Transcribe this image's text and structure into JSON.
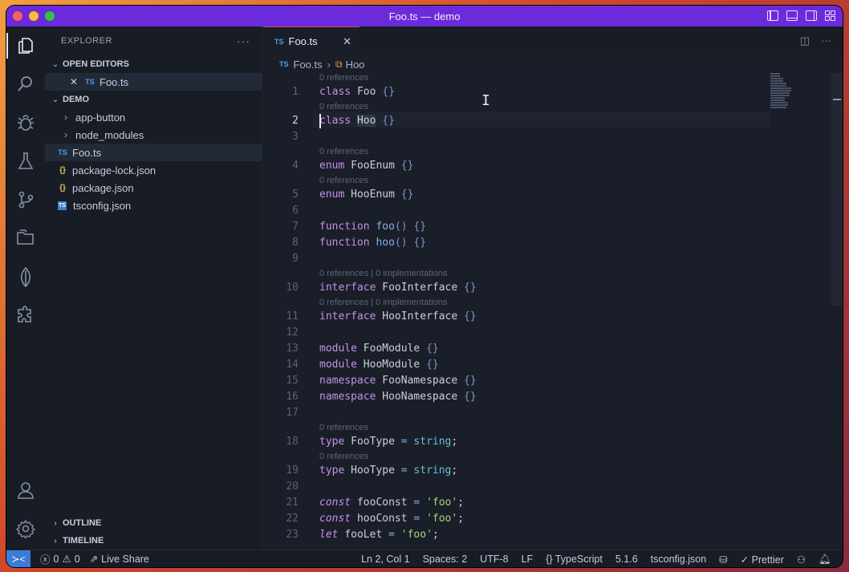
{
  "window": {
    "title": "Foo.ts — demo"
  },
  "sidebar": {
    "header": "EXPLORER",
    "more": "···",
    "open_editors": {
      "label": "OPEN EDITORS",
      "items": [
        {
          "icon": "TS",
          "label": "Foo.ts"
        }
      ]
    },
    "workspace": {
      "label": "DEMO",
      "items": [
        {
          "type": "folder",
          "label": "app-button"
        },
        {
          "type": "folder",
          "label": "node_modules"
        },
        {
          "type": "ts",
          "icon": "TS",
          "label": "Foo.ts"
        },
        {
          "type": "json",
          "icon": "{}",
          "label": "package-lock.json"
        },
        {
          "type": "json",
          "icon": "{}",
          "label": "package.json"
        },
        {
          "type": "tsconfig",
          "icon": "TS",
          "label": "tsconfig.json"
        }
      ]
    },
    "outline_label": "OUTLINE",
    "timeline_label": "TIMELINE"
  },
  "editor": {
    "tab": {
      "icon": "TS",
      "label": "Foo.ts"
    },
    "breadcrumb": {
      "file": "Foo.ts",
      "symbol": "Hoo"
    },
    "lens": {
      "ref": "0 references",
      "ref_impl": "0 references | 0 implementations"
    },
    "lines": {
      "1": "class Foo {}",
      "2": "class Hoo {}",
      "4": "enum FooEnum {}",
      "5": "enum HooEnum {}",
      "7": "function foo() {}",
      "8": "function hoo() {}",
      "10": "interface FooInterface {}",
      "11": "interface HooInterface {}",
      "13": "module FooModule {}",
      "14": "module HooModule {}",
      "15": "namespace FooNamespace {}",
      "16": "namespace HooNamespace {}",
      "18": "type FooType = string;",
      "19": "type HooType = string;",
      "21": "const fooConst = 'foo';",
      "22": "const hooConst = 'foo';",
      "23": "let fooLet = 'foo';"
    },
    "line_numbers": [
      "1",
      "2",
      "3",
      "4",
      "5",
      "6",
      "7",
      "8",
      "9",
      "10",
      "11",
      "12",
      "13",
      "14",
      "15",
      "16",
      "17",
      "18",
      "19",
      "20",
      "21",
      "22",
      "23"
    ]
  },
  "statusbar": {
    "errors": "0",
    "warnings": "0",
    "live_share": "Live Share",
    "position": "Ln 2, Col 1",
    "spaces": "Spaces: 2",
    "encoding": "UTF-8",
    "eol": "LF",
    "language": "TypeScript",
    "version": "5.1.6",
    "tsconfig": "tsconfig.json",
    "prettier": "Prettier"
  },
  "colors": {
    "titlebar": "#6b2bdb",
    "tab_accent": "#d24a4a",
    "remote": "#3d7bd8"
  }
}
